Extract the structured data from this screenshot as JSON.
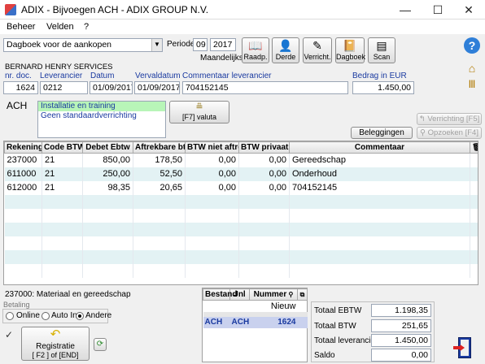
{
  "window": {
    "title": "ADIX - Bijvoegen ACH - ADIX GROUP N.V.",
    "minimize": "—",
    "maximize": "☐",
    "close": "✕"
  },
  "menu": [
    "Beheer",
    "Velden",
    "?"
  ],
  "toolbar": {
    "journal_select": "Dagboek voor de aankopen",
    "periode_label": "Periode",
    "periode": "09",
    "year": "2017",
    "periodicity": "Maandelijkse",
    "buttons": [
      "Raadp.",
      "Derde",
      "Verricht.",
      "Dagboek",
      "Scan"
    ]
  },
  "supplier_name": "BERNARD HENRY SERVICES",
  "header": {
    "labels": {
      "doc": "nr. doc.",
      "leverancier": "Leverancier",
      "datum": "Datum",
      "vervaldatum": "Vervaldatum",
      "commentaar": "Commentaar leverancier",
      "bedrag": "Bedrag in EUR"
    },
    "doc": "1624",
    "leverancier": "0212",
    "datum": "01/09/2017",
    "vervaldatum": "01/09/2017",
    "commentaar": "704152145",
    "bedrag": "1.450,00"
  },
  "journal_code": "ACH",
  "operation_list": [
    "Installatie en training",
    "Geen standaardverrichting"
  ],
  "valuta_button": "[F7] valuta",
  "side_buttons": {
    "verrichting": "Verrichting [F5]",
    "beleggingen": "Beleggingen",
    "opzoeken": "Opzoeken [F4]"
  },
  "grid": {
    "columns": [
      "Rekening",
      "Code BTW",
      "Debet Ebtw",
      "Aftrekbare btw",
      "BTW niet aftrekb",
      "BTW privaat",
      "Commentaar"
    ],
    "rows": [
      [
        "237000",
        "21",
        "850,00",
        "178,50",
        "0,00",
        "0,00",
        "Gereedschap"
      ],
      [
        "611000",
        "21",
        "250,00",
        "52,50",
        "0,00",
        "0,00",
        "Onderhoud"
      ],
      [
        "612000",
        "21",
        "98,35",
        "20,65",
        "0,00",
        "0,00",
        "704152145"
      ]
    ]
  },
  "status_text": "237000: Materiaal en gereedschap",
  "betaling": {
    "label": "Betaling",
    "options": [
      "Online",
      "Auto In.",
      "Andere"
    ],
    "selected": "Andere"
  },
  "registratie": {
    "line1": "Registratie",
    "line2": "[ F2 ] of [END]"
  },
  "mini": {
    "columns": [
      "Bestand",
      "Jnl",
      "Nummer"
    ],
    "new_label": "Nieuw",
    "row": [
      "ACH",
      "ACH",
      "1624"
    ]
  },
  "totals": [
    {
      "label": "Totaal EBTW",
      "value": "1.198,35"
    },
    {
      "label": "Totaal BTW",
      "value": "251,65"
    },
    {
      "label": "Totaal leverancier",
      "value": "1.450,00"
    },
    {
      "label": "Saldo",
      "value": "0,00"
    }
  ],
  "colors": {
    "accent": "#1a3aa0",
    "row_alt": "#e3f2f4",
    "selected_op": "#b8f5b8",
    "mini_sel": "#c9d1ee"
  }
}
